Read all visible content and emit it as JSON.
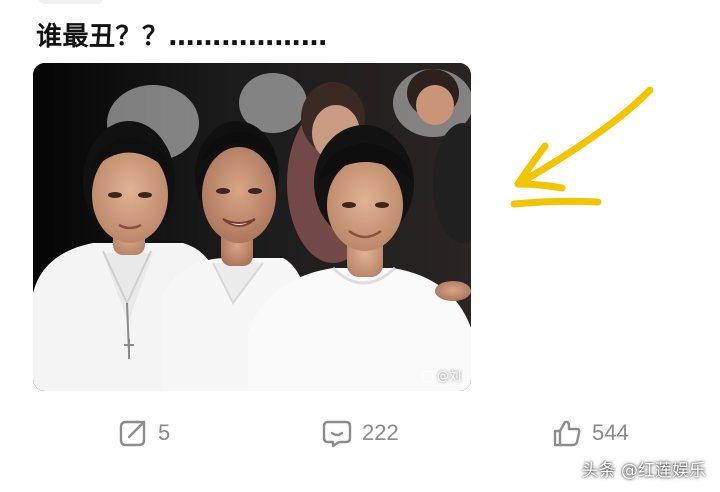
{
  "post": {
    "text": "谁最丑？？………………",
    "image_watermark": "@刘"
  },
  "actions": {
    "repost_count": "5",
    "comment_count": "222",
    "like_count": "544"
  },
  "icons": {
    "repost": "share-edit-icon",
    "comment": "comment-bubble-icon",
    "like": "thumbs-up-icon",
    "annotation": "yellow-arrow-icon"
  },
  "colors": {
    "annotation_arrow": "#f2c500",
    "action_gray": "#8c8c8c"
  },
  "footer": {
    "watermark": "头条 @红莲娱乐"
  }
}
